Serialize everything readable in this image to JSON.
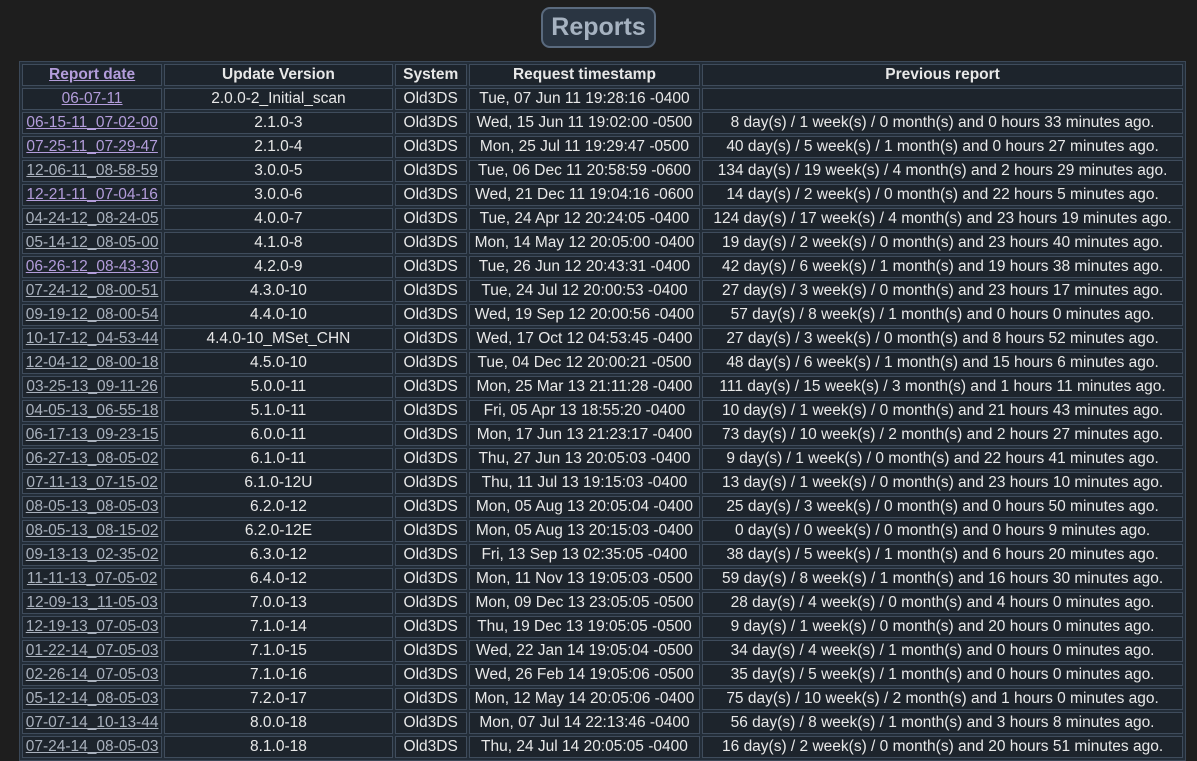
{
  "page_title": "Reports",
  "columns": [
    "Report date",
    "Update Version",
    "System",
    "Request timestamp",
    "Previous report"
  ],
  "rows": [
    {
      "date": "06-07-11",
      "version": "2.0.0-2_Initial_scan",
      "system": "Old3DS",
      "timestamp": "Tue, 07 Jun 11 19:28:16 -0400",
      "previous": "",
      "visited": true
    },
    {
      "date": "06-15-11_07-02-00",
      "version": "2.1.0-3",
      "system": "Old3DS",
      "timestamp": "Wed, 15 Jun 11 19:02:00 -0500",
      "previous": "8 day(s) / 1 week(s) / 0 month(s) and 0 hours 33 minutes ago.",
      "visited": true
    },
    {
      "date": "07-25-11_07-29-47",
      "version": "2.1.0-4",
      "system": "Old3DS",
      "timestamp": "Mon, 25 Jul 11 19:29:47 -0500",
      "previous": "40 day(s) / 5 week(s) / 1 month(s) and 0 hours 27 minutes ago.",
      "visited": true
    },
    {
      "date": "12-06-11_08-58-59",
      "version": "3.0.0-5",
      "system": "Old3DS",
      "timestamp": "Tue, 06 Dec 11 20:58:59 -0600",
      "previous": "134 day(s) / 19 week(s) / 4 month(s) and 2 hours 29 minutes ago.",
      "visited": false
    },
    {
      "date": "12-21-11_07-04-16",
      "version": "3.0.0-6",
      "system": "Old3DS",
      "timestamp": "Wed, 21 Dec 11 19:04:16 -0600",
      "previous": "14 day(s) / 2 week(s) / 0 month(s) and 22 hours 5 minutes ago.",
      "visited": true
    },
    {
      "date": "04-24-12_08-24-05",
      "version": "4.0.0-7",
      "system": "Old3DS",
      "timestamp": "Tue, 24 Apr 12 20:24:05 -0400",
      "previous": "124 day(s) / 17 week(s) / 4 month(s) and 23 hours 19 minutes ago.",
      "visited": false
    },
    {
      "date": "05-14-12_08-05-00",
      "version": "4.1.0-8",
      "system": "Old3DS",
      "timestamp": "Mon, 14 May 12 20:05:00 -0400",
      "previous": "19 day(s) / 2 week(s) / 0 month(s) and 23 hours 40 minutes ago.",
      "visited": false
    },
    {
      "date": "06-26-12_08-43-30",
      "version": "4.2.0-9",
      "system": "Old3DS",
      "timestamp": "Tue, 26 Jun 12 20:43:31 -0400",
      "previous": "42 day(s) / 6 week(s) / 1 month(s) and 19 hours 38 minutes ago.",
      "visited": true
    },
    {
      "date": "07-24-12_08-00-51",
      "version": "4.3.0-10",
      "system": "Old3DS",
      "timestamp": "Tue, 24 Jul 12 20:00:53 -0400",
      "previous": "27 day(s) / 3 week(s) / 0 month(s) and 23 hours 17 minutes ago.",
      "visited": false
    },
    {
      "date": "09-19-12_08-00-54",
      "version": "4.4.0-10",
      "system": "Old3DS",
      "timestamp": "Wed, 19 Sep 12 20:00:56 -0400",
      "previous": "57 day(s) / 8 week(s) / 1 month(s) and 0 hours 0 minutes ago.",
      "visited": false
    },
    {
      "date": "10-17-12_04-53-44",
      "version": "4.4.0-10_MSet_CHN",
      "system": "Old3DS",
      "timestamp": "Wed, 17 Oct 12 04:53:45 -0400",
      "previous": "27 day(s) / 3 week(s) / 0 month(s) and 8 hours 52 minutes ago.",
      "visited": false
    },
    {
      "date": "12-04-12_08-00-18",
      "version": "4.5.0-10",
      "system": "Old3DS",
      "timestamp": "Tue, 04 Dec 12 20:00:21 -0500",
      "previous": "48 day(s) / 6 week(s) / 1 month(s) and 15 hours 6 minutes ago.",
      "visited": false
    },
    {
      "date": "03-25-13_09-11-26",
      "version": "5.0.0-11",
      "system": "Old3DS",
      "timestamp": "Mon, 25 Mar 13 21:11:28 -0400",
      "previous": "111 day(s) / 15 week(s) / 3 month(s) and 1 hours 11 minutes ago.",
      "visited": false
    },
    {
      "date": "04-05-13_06-55-18",
      "version": "5.1.0-11",
      "system": "Old3DS",
      "timestamp": "Fri, 05 Apr 13 18:55:20 -0400",
      "previous": "10 day(s) / 1 week(s) / 0 month(s) and 21 hours 43 minutes ago.",
      "visited": false
    },
    {
      "date": "06-17-13_09-23-15",
      "version": "6.0.0-11",
      "system": "Old3DS",
      "timestamp": "Mon, 17 Jun 13 21:23:17 -0400",
      "previous": "73 day(s) / 10 week(s) / 2 month(s) and 2 hours 27 minutes ago.",
      "visited": false
    },
    {
      "date": "06-27-13_08-05-02",
      "version": "6.1.0-11",
      "system": "Old3DS",
      "timestamp": "Thu, 27 Jun 13 20:05:03 -0400",
      "previous": "9 day(s) / 1 week(s) / 0 month(s) and 22 hours 41 minutes ago.",
      "visited": false
    },
    {
      "date": "07-11-13_07-15-02",
      "version": "6.1.0-12U",
      "system": "Old3DS",
      "timestamp": "Thu, 11 Jul 13 19:15:03 -0400",
      "previous": "13 day(s) / 1 week(s) / 0 month(s) and 23 hours 10 minutes ago.",
      "visited": false
    },
    {
      "date": "08-05-13_08-05-03",
      "version": "6.2.0-12",
      "system": "Old3DS",
      "timestamp": "Mon, 05 Aug 13 20:05:04 -0400",
      "previous": "25 day(s) / 3 week(s) / 0 month(s) and 0 hours 50 minutes ago.",
      "visited": false
    },
    {
      "date": "08-05-13_08-15-02",
      "version": "6.2.0-12E",
      "system": "Old3DS",
      "timestamp": "Mon, 05 Aug 13 20:15:03 -0400",
      "previous": "0 day(s) / 0 week(s) / 0 month(s) and 0 hours 9 minutes ago.",
      "visited": false
    },
    {
      "date": "09-13-13_02-35-02",
      "version": "6.3.0-12",
      "system": "Old3DS",
      "timestamp": "Fri, 13 Sep 13 02:35:05 -0400",
      "previous": "38 day(s) / 5 week(s) / 1 month(s) and 6 hours 20 minutes ago.",
      "visited": false
    },
    {
      "date": "11-11-13_07-05-02",
      "version": "6.4.0-12",
      "system": "Old3DS",
      "timestamp": "Mon, 11 Nov 13 19:05:03 -0500",
      "previous": "59 day(s) / 8 week(s) / 1 month(s) and 16 hours 30 minutes ago.",
      "visited": false
    },
    {
      "date": "12-09-13_11-05-03",
      "version": "7.0.0-13",
      "system": "Old3DS",
      "timestamp": "Mon, 09 Dec 13 23:05:05 -0500",
      "previous": "28 day(s) / 4 week(s) / 0 month(s) and 4 hours 0 minutes ago.",
      "visited": false
    },
    {
      "date": "12-19-13_07-05-03",
      "version": "7.1.0-14",
      "system": "Old3DS",
      "timestamp": "Thu, 19 Dec 13 19:05:05 -0500",
      "previous": "9 day(s) / 1 week(s) / 0 month(s) and 20 hours 0 minutes ago.",
      "visited": false
    },
    {
      "date": "01-22-14_07-05-03",
      "version": "7.1.0-15",
      "system": "Old3DS",
      "timestamp": "Wed, 22 Jan 14 19:05:04 -0500",
      "previous": "34 day(s) / 4 week(s) / 1 month(s) and 0 hours 0 minutes ago.",
      "visited": false
    },
    {
      "date": "02-26-14_07-05-03",
      "version": "7.1.0-16",
      "system": "Old3DS",
      "timestamp": "Wed, 26 Feb 14 19:05:06 -0500",
      "previous": "35 day(s) / 5 week(s) / 1 month(s) and 0 hours 0 minutes ago.",
      "visited": false
    },
    {
      "date": "05-12-14_08-05-03",
      "version": "7.2.0-17",
      "system": "Old3DS",
      "timestamp": "Mon, 12 May 14 20:05:06 -0400",
      "previous": "75 day(s) / 10 week(s) / 2 month(s) and 1 hours 0 minutes ago.",
      "visited": false
    },
    {
      "date": "07-07-14_10-13-44",
      "version": "8.0.0-18",
      "system": "Old3DS",
      "timestamp": "Mon, 07 Jul 14 22:13:46 -0400",
      "previous": "56 day(s) / 8 week(s) / 1 month(s) and 3 hours 8 minutes ago.",
      "visited": false
    },
    {
      "date": "07-24-14_08-05-03",
      "version": "8.1.0-18",
      "system": "Old3DS",
      "timestamp": "Thu, 24 Jul 14 20:05:05 -0400",
      "previous": "16 day(s) / 2 week(s) / 0 month(s) and 20 hours 51 minutes ago.",
      "visited": false
    }
  ]
}
